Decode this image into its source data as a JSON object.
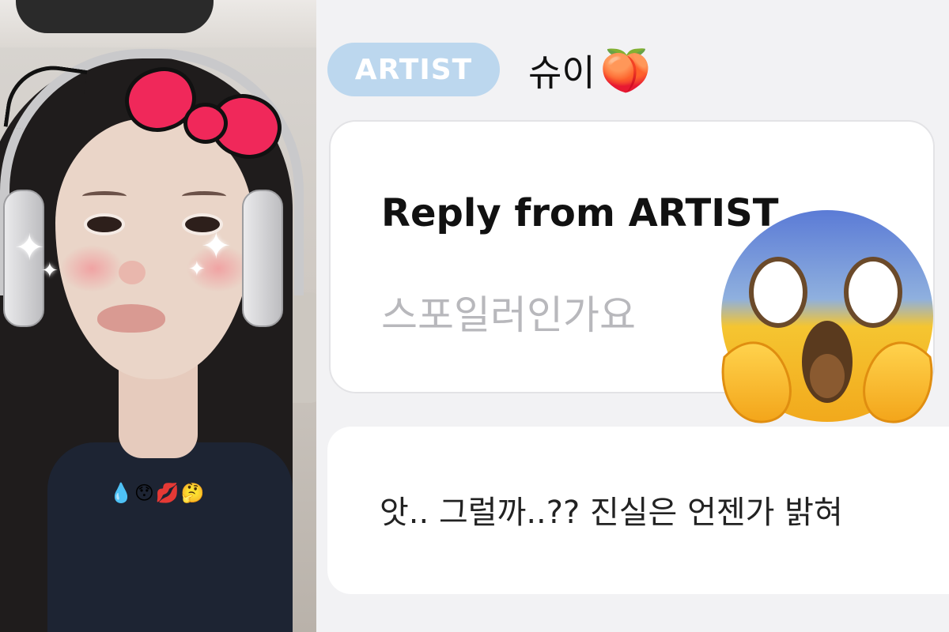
{
  "chat": {
    "artist_badge": "ARTIST",
    "artist_name": "슈이",
    "artist_name_emoji": "🍑",
    "reply_card": {
      "title": "Reply from ARTIST",
      "body": "스포일러인가요"
    },
    "message": {
      "text": "앗.. 그럴까..?? 진실은 언젠가 밝혀"
    }
  },
  "photo": {
    "emoji_row": "💧😯💋🤔",
    "sparkle": "✦"
  },
  "overlay": {
    "icon": "screaming-face-emoji"
  },
  "colors": {
    "badge_bg": "#bcd7ee",
    "bow": "#f0285a",
    "chat_bg": "#f2f2f4",
    "card_bg": "#ffffff"
  }
}
